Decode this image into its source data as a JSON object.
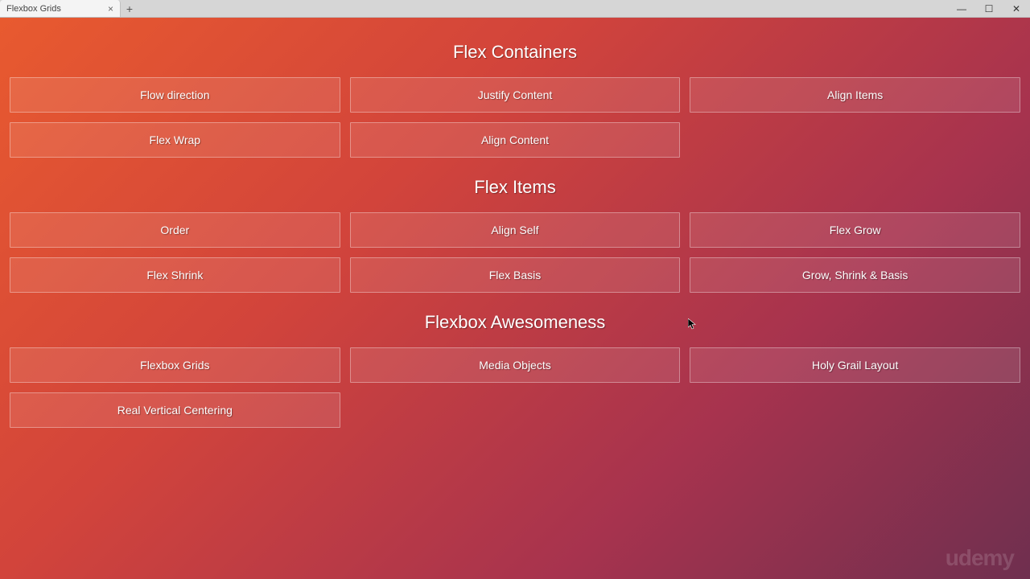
{
  "browser": {
    "tab_title": "Flexbox Grids",
    "tab_close_glyph": "×",
    "new_tab_glyph": "+",
    "min_glyph": "—",
    "max_glyph": "☐",
    "close_glyph": "✕"
  },
  "sections": {
    "containers": {
      "title": "Flex Containers",
      "tiles": [
        "Flow direction",
        "Justify Content",
        "Align Items",
        "Flex Wrap",
        "Align Content"
      ]
    },
    "items": {
      "title": "Flex Items",
      "tiles": [
        "Order",
        "Align Self",
        "Flex Grow",
        "Flex Shrink",
        "Flex Basis",
        "Grow, Shrink & Basis"
      ]
    },
    "awesome": {
      "title": "Flexbox Awesomeness",
      "tiles": [
        "Flexbox Grids",
        "Media Objects",
        "Holy Grail Layout",
        "Real Vertical Centering"
      ]
    }
  },
  "watermark": "udemy"
}
